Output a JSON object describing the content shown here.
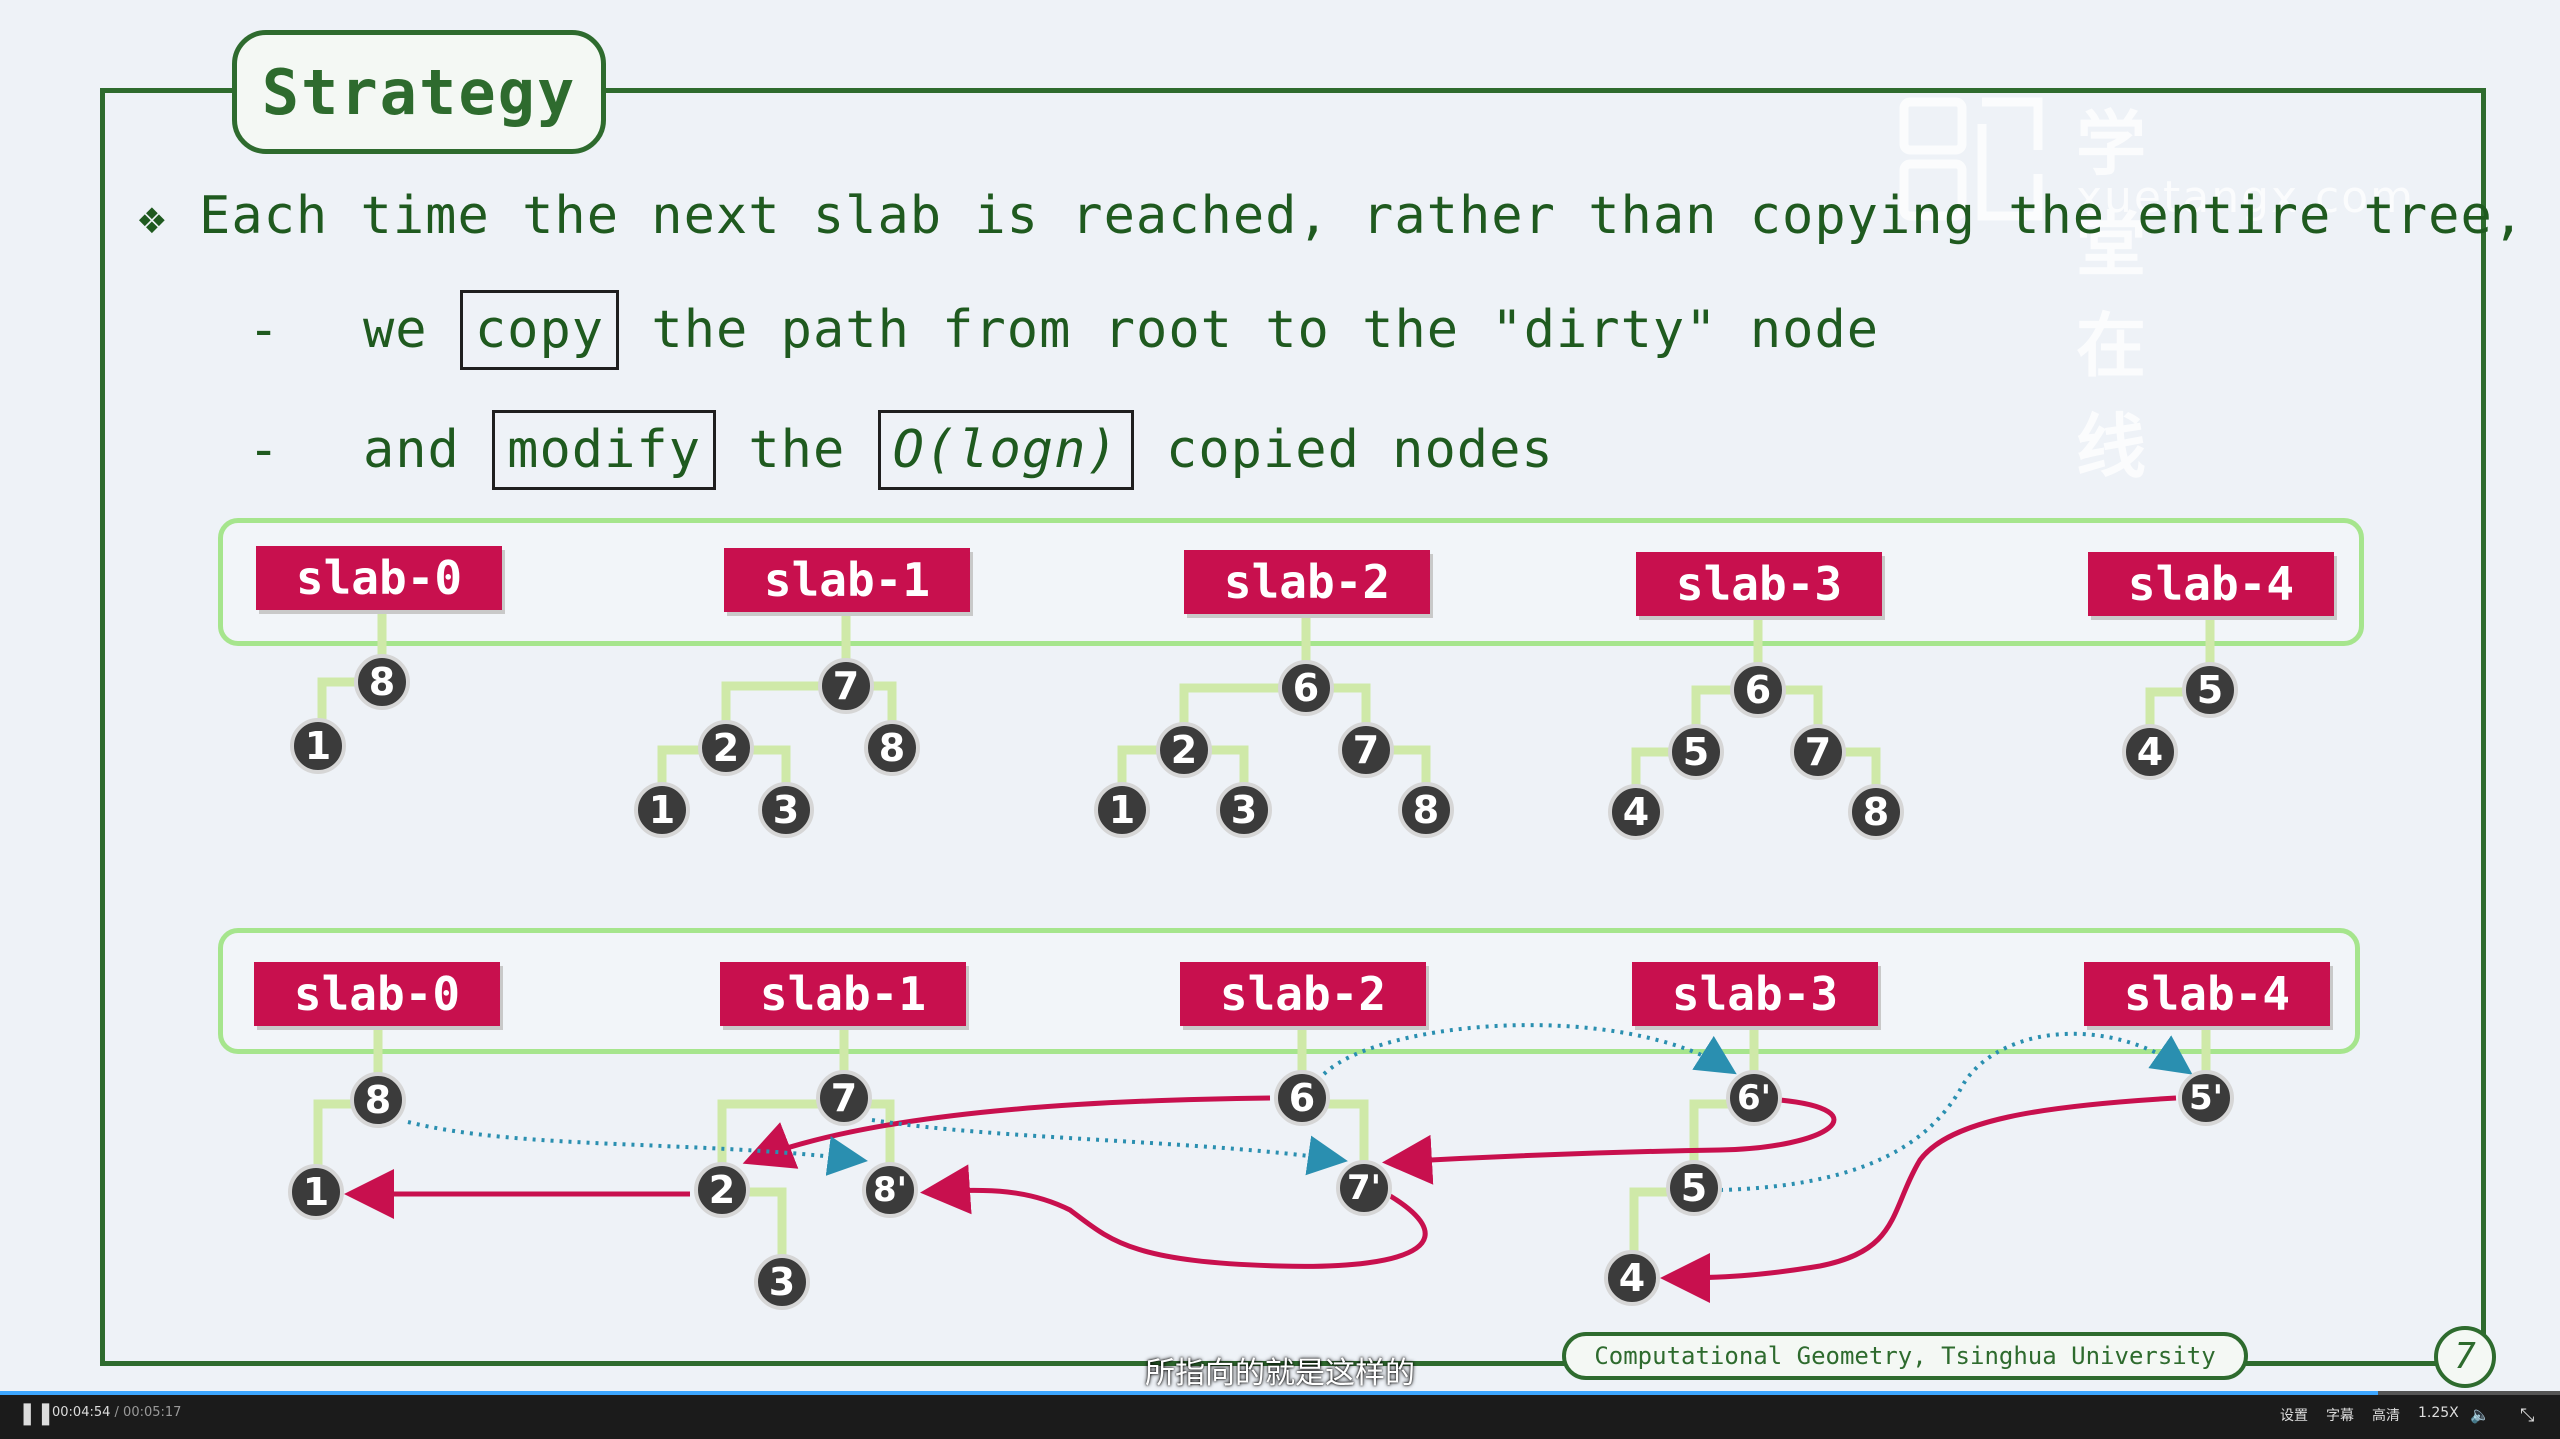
{
  "slide": {
    "title": "Strategy",
    "bullet_icon": "diamond-cluster-icon",
    "bullet_line": "Each time the next slab is reached, rather than copying the entire tree,",
    "sub1": {
      "dash": "-",
      "pre": "we",
      "boxed": "copy",
      "post": "the path from root to the \"dirty\" node"
    },
    "sub2": {
      "dash": "-",
      "pre": "and",
      "boxed1": "modify",
      "mid": "the",
      "boxed2": "O(logn)",
      "post": "copied nodes"
    },
    "footer": "Computational Geometry, Tsinghua University",
    "page_number": "7"
  },
  "top_row": {
    "slabs": [
      "slab-0",
      "slab-1",
      "slab-2",
      "slab-3",
      "slab-4"
    ],
    "trees": [
      [
        "8",
        "1"
      ],
      [
        "7",
        "2",
        "8",
        "1",
        "3"
      ],
      [
        "6",
        "2",
        "7",
        "1",
        "3",
        "8"
      ],
      [
        "6",
        "5",
        "7",
        "4",
        "8"
      ],
      [
        "5",
        "4"
      ]
    ]
  },
  "bottom_row": {
    "slabs": [
      "slab-0",
      "slab-1",
      "slab-2",
      "slab-3",
      "slab-4"
    ],
    "nodes": [
      "8",
      "1",
      "7",
      "2",
      "3",
      "8'",
      "6",
      "7'",
      "6'",
      "5",
      "4",
      "5'"
    ]
  },
  "watermark": {
    "text": "学堂在线",
    "url": "xuetangx.com"
  },
  "colors": {
    "accent": "#c8104e",
    "frame": "#2e6b2e",
    "panel": "#a6e58d",
    "path": "#c8104e",
    "link": "#2a8fb0"
  },
  "player": {
    "state_icon": "pause-icon",
    "time_current": "00:04:54",
    "time_total": "00:05:17",
    "progress": 0.929,
    "subtitle": "所指向的就是这样的",
    "settings": "设置",
    "captions": "字幕",
    "quality": "高清",
    "speed": "1.25X",
    "volume_icon": "volume-icon",
    "exit_fullscreen_icon": "exit-fullscreen-icon"
  }
}
